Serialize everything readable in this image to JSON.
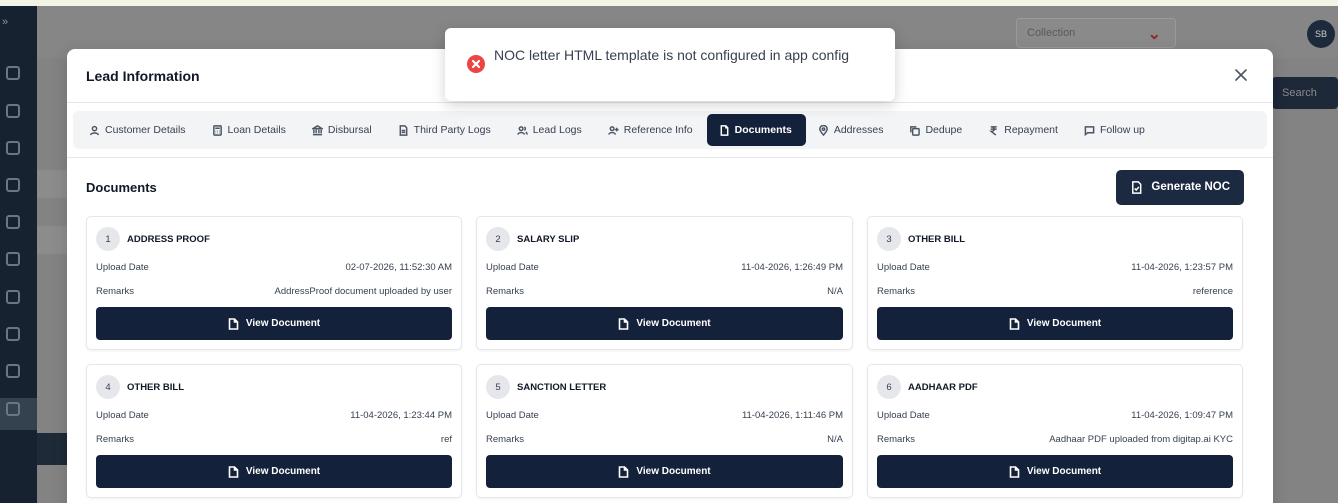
{
  "background": {
    "collection_select": "Collection",
    "user_initials": "SB",
    "search_button": "Search"
  },
  "modal": {
    "title": "Lead Information",
    "tabs": [
      {
        "label": "Customer Details",
        "icon": "user-icon"
      },
      {
        "label": "Loan Details",
        "icon": "calculator-icon"
      },
      {
        "label": "Disbursal",
        "icon": "bank-icon"
      },
      {
        "label": "Third Party Logs",
        "icon": "log-file-icon"
      },
      {
        "label": "Lead Logs",
        "icon": "users-icon"
      },
      {
        "label": "Reference Info",
        "icon": "user-plus-icon"
      },
      {
        "label": "Documents",
        "icon": "document-icon",
        "active": true
      },
      {
        "label": "Addresses",
        "icon": "map-pin-icon"
      },
      {
        "label": "Dedupe",
        "icon": "copy-icon"
      },
      {
        "label": "Repayment",
        "icon": "rupee-icon"
      },
      {
        "label": "Follow up",
        "icon": "message-icon"
      }
    ],
    "documents": {
      "title": "Documents",
      "generate_button": "Generate NOC",
      "upload_date_label": "Upload Date",
      "remarks_label": "Remarks",
      "view_button": "View Document",
      "items": [
        {
          "num": "1",
          "name": "ADDRESS PROOF",
          "upload_date": "02-07-2026, 11:52:30 AM",
          "remarks": "AddressProof document uploaded by user"
        },
        {
          "num": "2",
          "name": "SALARY SLIP",
          "upload_date": "11-04-2026, 1:26:49 PM",
          "remarks": "N/A"
        },
        {
          "num": "3",
          "name": "OTHER BILL",
          "upload_date": "11-04-2026, 1:23:57 PM",
          "remarks": "reference"
        },
        {
          "num": "4",
          "name": "OTHER BILL",
          "upload_date": "11-04-2026, 1:23:44 PM",
          "remarks": "ref"
        },
        {
          "num": "5",
          "name": "SANCTION LETTER",
          "upload_date": "11-04-2026, 1:11:46 PM",
          "remarks": "N/A"
        },
        {
          "num": "6",
          "name": "AADHAAR PDF",
          "upload_date": "11-04-2026, 1:09:47 PM",
          "remarks": "Aadhaar PDF uploaded from digitap.ai KYC"
        }
      ]
    }
  },
  "toast": {
    "message": "NOC letter HTML template is not configured in app config",
    "icon": "error-icon",
    "color": "#ef4444"
  },
  "colors": {
    "primary_dark": "#14213a",
    "error": "#ef4444"
  }
}
